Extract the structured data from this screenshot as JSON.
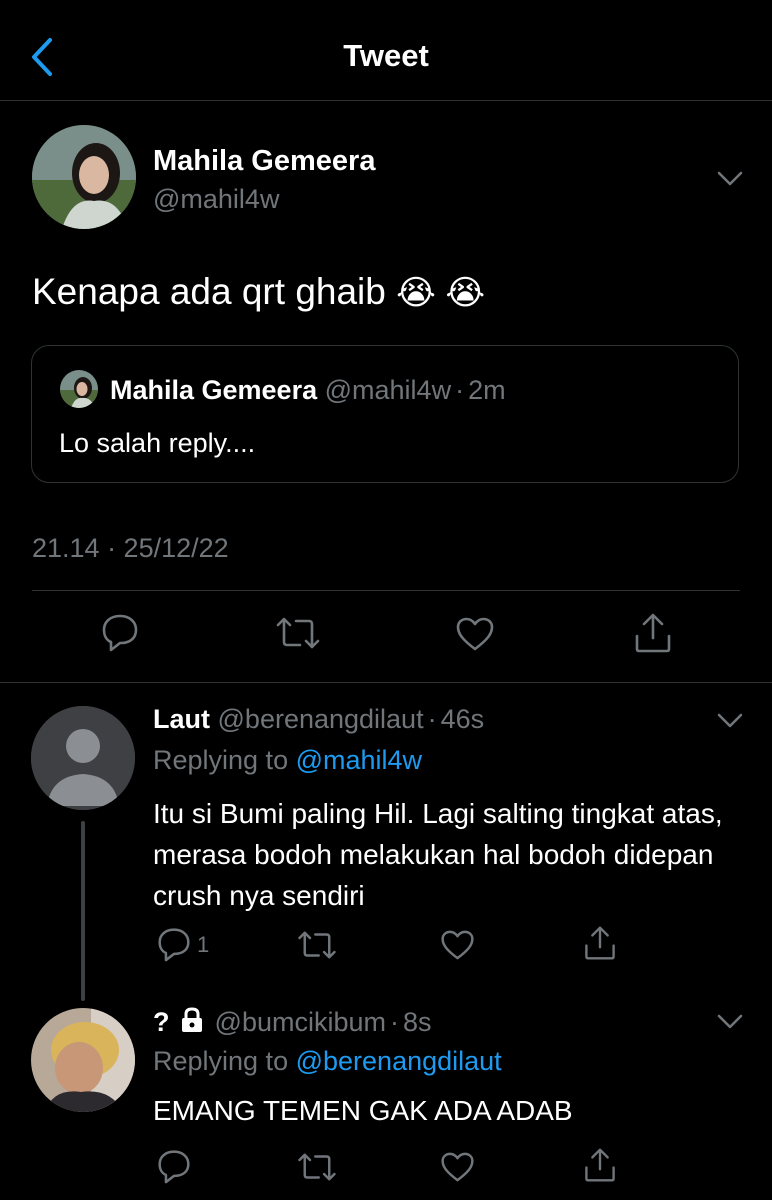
{
  "header": {
    "title": "Tweet"
  },
  "tweet": {
    "author_name": "Mahila Gemeera",
    "author_handle": "@mahil4w",
    "text": "Kenapa ada qrt ghaib",
    "emoji": "😭 😭",
    "quote": {
      "author_name": "Mahila Gemeera",
      "author_handle": "@mahil4w",
      "sep": "·",
      "time": "2m",
      "text": "Lo salah reply...."
    },
    "timestamp": "21.14 · 25/12/22"
  },
  "replies": [
    {
      "name": "Laut",
      "handle": "@berenangdilaut",
      "sep": "·",
      "time": "46s",
      "replying_prefix": "Replying to",
      "replying_to": "@mahil4w",
      "text": "Itu si Bumi paling Hil. Lagi salting tingkat atas, merasa bodoh melakukan hal bodoh didepan crush nya sendiri",
      "reply_count": "1"
    },
    {
      "name": "?",
      "handle": "@bumcikibum",
      "sep": "·",
      "time": "8s",
      "replying_prefix": "Replying to",
      "replying_to": "@berenangdilaut",
      "text": "EMANG TEMEN GAK ADA ADAB",
      "reply_count": ""
    }
  ],
  "icons": {
    "back": "chevron-left-icon",
    "more": "chevron-down-icon",
    "reply": "speech-bubble-icon",
    "retweet": "retweet-icon",
    "like": "heart-icon",
    "share": "share-icon",
    "lock": "lock-icon"
  },
  "colors": {
    "background": "#000000",
    "accent": "#1d9bf0",
    "text": "#e7e9ea",
    "muted": "#71767b",
    "divider": "#2f3336"
  }
}
